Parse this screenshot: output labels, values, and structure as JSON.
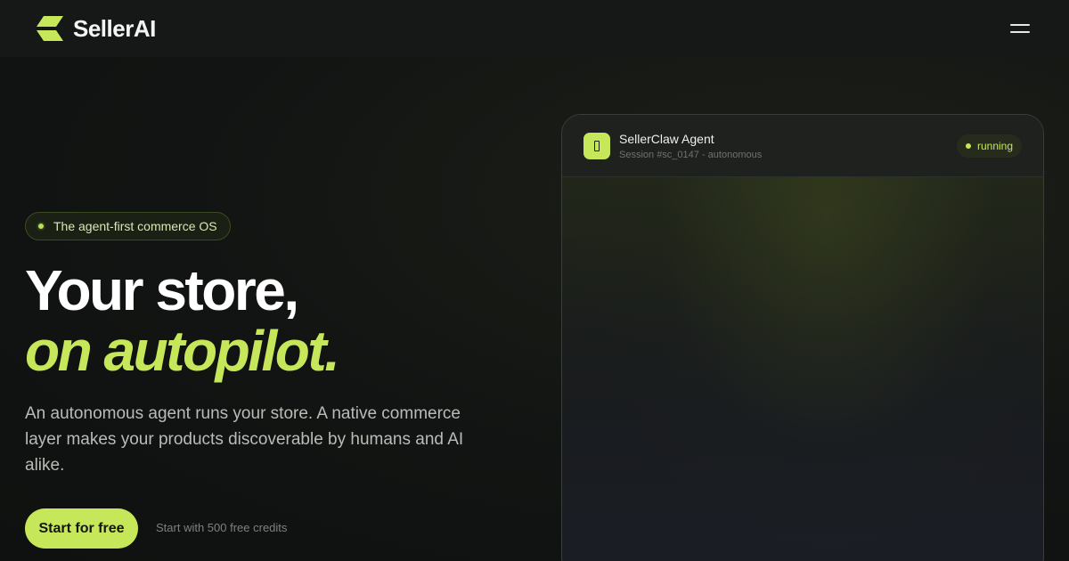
{
  "brand": {
    "name": "SellerAI"
  },
  "hero": {
    "badge": "The agent-first commerce OS",
    "headline_line1": "Your store,",
    "headline_line2": "on autopilot.",
    "description": "An autonomous agent runs your store. A native commerce layer makes your products discoverable by humans and AI alike.",
    "cta_label": "Start for free",
    "cta_note": "Start with 500 free credits"
  },
  "agent_panel": {
    "icon": "square-outline-icon",
    "name": "SellerClaw Agent",
    "session": "Session #sc_0147 - autonomous",
    "status": "running"
  },
  "colors": {
    "accent": "#c6e75a",
    "background": "#111312",
    "header": "#161817"
  }
}
